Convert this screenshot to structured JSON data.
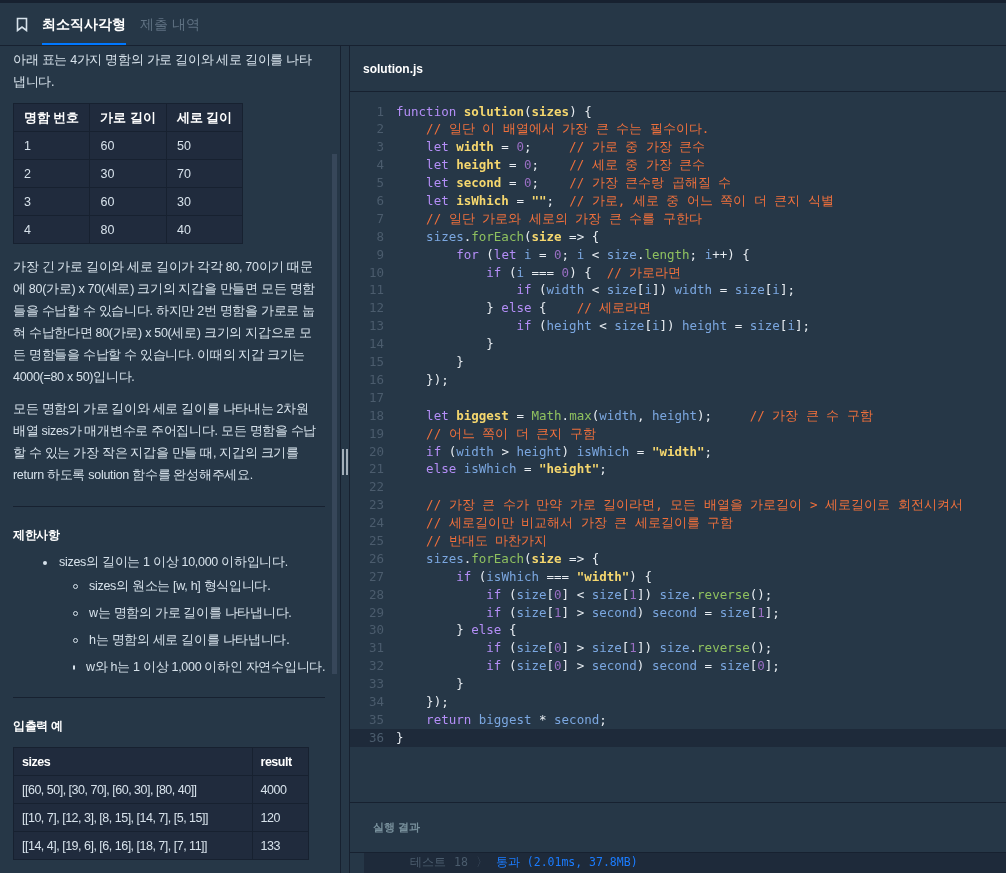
{
  "header": {
    "tabs": [
      {
        "label": "최소직사각형",
        "selected": true
      },
      {
        "label": "제출 내역",
        "selected": false
      }
    ]
  },
  "description": {
    "intro": "아래 표는 4가지 명함의 가로 길이와 세로 길이를 나타냅니다.",
    "cards_table": {
      "columns": [
        "명함 번호",
        "가로 길이",
        "세로 길이"
      ],
      "rows": [
        [
          "1",
          "60",
          "50"
        ],
        [
          "2",
          "30",
          "70"
        ],
        [
          "3",
          "60",
          "30"
        ],
        [
          "4",
          "80",
          "40"
        ]
      ]
    },
    "paragraphs": [
      "가장 긴 가로 길이와 세로 길이가 각각 80, 70이기 때문에 80(가로) x 70(세로) 크기의 지갑을 만들면 모든 명함들을 수납할 수 있습니다. 하지만 2번 명함을 가로로 눕혀 수납한다면 80(가로) x 50(세로) 크기의 지갑으로 모든 명함들을 수납할 수 있습니다. 이때의 지갑 크기는 4000(=80 x 50)입니다.",
      "모든 명함의 가로 길이와 세로 길이를 나타내는 2차원 배열 sizes가 매개변수로 주어집니다. 모든 명함을 수납할 수 있는 가장 작은 지갑을 만들 때, 지갑의 크기를 return 하도록 solution 함수를 완성해주세요."
    ],
    "constraints_title": "제한사항",
    "constraints": [
      {
        "text": "sizes의 길이는 1 이상 10,000 이하입니다.",
        "children": [
          {
            "text": "sizes의 원소는 [w, h] 형식입니다."
          },
          {
            "text": "w는 명함의 가로 길이를 나타냅니다."
          },
          {
            "text": "h는 명함의 세로 길이를 나타냅니다."
          },
          {
            "text": "w와 h는 1 이상 1,000 이하인 자연수입니다."
          }
        ]
      }
    ],
    "examples_title": "입출력 예",
    "examples_table": {
      "columns": [
        "sizes",
        "result"
      ],
      "rows": [
        [
          "[[60, 50], [30, 70], [60, 30], [80, 40]]",
          "4000"
        ],
        [
          "[[10, 7], [12, 3], [8, 15], [14, 7], [5, 15]]",
          "120"
        ],
        [
          "[[14, 4], [19, 6], [6, 16], [18, 7], [7, 11]]",
          "133"
        ]
      ]
    }
  },
  "editor": {
    "filename": "solution.js",
    "lines": [
      {
        "number": "1",
        "current": false,
        "tokens": [
          {
            "kind": "keyword",
            "text": "function"
          },
          {
            "kind": "name",
            "text": " solution"
          },
          {
            "kind": "plain",
            "text": "("
          },
          {
            "kind": "name",
            "text": "sizes"
          },
          {
            "kind": "plain",
            "text": ") {"
          }
        ]
      },
      {
        "number": "2",
        "current": false,
        "tokens": [
          {
            "kind": "comment",
            "text": "    // 일단 이 배열에서 가장 큰 수는 필수이다."
          }
        ]
      },
      {
        "number": "3",
        "current": false,
        "tokens": [
          {
            "kind": "keyword",
            "text": "    let"
          },
          {
            "kind": "name",
            "text": " width"
          },
          {
            "kind": "plain",
            "text": " = "
          },
          {
            "kind": "number",
            "text": "0"
          },
          {
            "kind": "plain",
            "text": ";     "
          },
          {
            "kind": "comment",
            "text": "// 가로 중 가장 큰수"
          }
        ]
      },
      {
        "number": "4",
        "current": false,
        "tokens": [
          {
            "kind": "keyword",
            "text": "    let"
          },
          {
            "kind": "name",
            "text": " height"
          },
          {
            "kind": "plain",
            "text": " = "
          },
          {
            "kind": "number",
            "text": "0"
          },
          {
            "kind": "plain",
            "text": ";    "
          },
          {
            "kind": "comment",
            "text": "// 세로 중 가장 큰수"
          }
        ]
      },
      {
        "number": "5",
        "current": false,
        "tokens": [
          {
            "kind": "keyword",
            "text": "    let"
          },
          {
            "kind": "name",
            "text": " second"
          },
          {
            "kind": "plain",
            "text": " = "
          },
          {
            "kind": "number",
            "text": "0"
          },
          {
            "kind": "plain",
            "text": ";    "
          },
          {
            "kind": "comment",
            "text": "// 가장 큰수랑 곱해질 수"
          }
        ]
      },
      {
        "number": "6",
        "current": false,
        "tokens": [
          {
            "kind": "keyword",
            "text": "    let"
          },
          {
            "kind": "name",
            "text": " isWhich"
          },
          {
            "kind": "plain",
            "text": " = "
          },
          {
            "kind": "string",
            "text": "\"\""
          },
          {
            "kind": "plain",
            "text": ";  "
          },
          {
            "kind": "comment",
            "text": "// 가로, 세로 중 어느 쪽이 더 큰지 식별"
          }
        ]
      },
      {
        "number": "7",
        "current": false,
        "tokens": [
          {
            "kind": "comment",
            "text": "    // 일단 가로와 세로의 가장 큰 수를 구한다"
          }
        ]
      },
      {
        "number": "8",
        "current": false,
        "tokens": [
          {
            "kind": "variable",
            "text": "    sizes"
          },
          {
            "kind": "plain",
            "text": "."
          },
          {
            "kind": "method",
            "text": "forEach"
          },
          {
            "kind": "plain",
            "text": "("
          },
          {
            "kind": "name",
            "text": "size"
          },
          {
            "kind": "plain",
            "text": " => {"
          }
        ]
      },
      {
        "number": "9",
        "current": false,
        "tokens": [
          {
            "kind": "keyword",
            "text": "        for"
          },
          {
            "kind": "plain",
            "text": " ("
          },
          {
            "kind": "keyword",
            "text": "let"
          },
          {
            "kind": "variable",
            "text": " i"
          },
          {
            "kind": "plain",
            "text": " = "
          },
          {
            "kind": "number",
            "text": "0"
          },
          {
            "kind": "plain",
            "text": "; "
          },
          {
            "kind": "variable",
            "text": "i"
          },
          {
            "kind": "plain",
            "text": " < "
          },
          {
            "kind": "variable",
            "text": "size"
          },
          {
            "kind": "plain",
            "text": "."
          },
          {
            "kind": "method",
            "text": "length"
          },
          {
            "kind": "plain",
            "text": "; "
          },
          {
            "kind": "variable",
            "text": "i"
          },
          {
            "kind": "plain",
            "text": "++) {"
          }
        ]
      },
      {
        "number": "10",
        "current": false,
        "tokens": [
          {
            "kind": "keyword",
            "text": "            if"
          },
          {
            "kind": "plain",
            "text": " ("
          },
          {
            "kind": "variable",
            "text": "i"
          },
          {
            "kind": "plain",
            "text": " === "
          },
          {
            "kind": "number",
            "text": "0"
          },
          {
            "kind": "plain",
            "text": ") {  "
          },
          {
            "kind": "comment",
            "text": "// 가로라면"
          }
        ]
      },
      {
        "number": "11",
        "current": false,
        "tokens": [
          {
            "kind": "keyword",
            "text": "                if"
          },
          {
            "kind": "plain",
            "text": " ("
          },
          {
            "kind": "variable",
            "text": "width"
          },
          {
            "kind": "plain",
            "text": " < "
          },
          {
            "kind": "variable",
            "text": "size"
          },
          {
            "kind": "plain",
            "text": "["
          },
          {
            "kind": "variable",
            "text": "i"
          },
          {
            "kind": "plain",
            "text": "]) "
          },
          {
            "kind": "variable",
            "text": "width"
          },
          {
            "kind": "plain",
            "text": " = "
          },
          {
            "kind": "variable",
            "text": "size"
          },
          {
            "kind": "plain",
            "text": "["
          },
          {
            "kind": "variable",
            "text": "i"
          },
          {
            "kind": "plain",
            "text": "];"
          }
        ]
      },
      {
        "number": "12",
        "current": false,
        "tokens": [
          {
            "kind": "plain",
            "text": "            } "
          },
          {
            "kind": "keyword",
            "text": "else"
          },
          {
            "kind": "plain",
            "text": " {    "
          },
          {
            "kind": "comment",
            "text": "// 세로라면"
          }
        ]
      },
      {
        "number": "13",
        "current": false,
        "tokens": [
          {
            "kind": "keyword",
            "text": "                if"
          },
          {
            "kind": "plain",
            "text": " ("
          },
          {
            "kind": "variable",
            "text": "height"
          },
          {
            "kind": "plain",
            "text": " < "
          },
          {
            "kind": "variable",
            "text": "size"
          },
          {
            "kind": "plain",
            "text": "["
          },
          {
            "kind": "variable",
            "text": "i"
          },
          {
            "kind": "plain",
            "text": "]) "
          },
          {
            "kind": "variable",
            "text": "height"
          },
          {
            "kind": "plain",
            "text": " = "
          },
          {
            "kind": "variable",
            "text": "size"
          },
          {
            "kind": "plain",
            "text": "["
          },
          {
            "kind": "variable",
            "text": "i"
          },
          {
            "kind": "plain",
            "text": "];"
          }
        ]
      },
      {
        "number": "14",
        "current": false,
        "tokens": [
          {
            "kind": "plain",
            "text": "            }"
          }
        ]
      },
      {
        "number": "15",
        "current": false,
        "tokens": [
          {
            "kind": "plain",
            "text": "        }"
          }
        ]
      },
      {
        "number": "16",
        "current": false,
        "tokens": [
          {
            "kind": "plain",
            "text": "    });"
          }
        ]
      },
      {
        "number": "17",
        "current": false
      },
      {
        "number": "18",
        "current": false,
        "tokens": [
          {
            "kind": "keyword",
            "text": "    let"
          },
          {
            "kind": "name",
            "text": " biggest"
          },
          {
            "kind": "plain",
            "text": " = "
          },
          {
            "kind": "method",
            "text": "Math"
          },
          {
            "kind": "plain",
            "text": "."
          },
          {
            "kind": "method",
            "text": "max"
          },
          {
            "kind": "plain",
            "text": "("
          },
          {
            "kind": "variable",
            "text": "width"
          },
          {
            "kind": "plain",
            "text": ", "
          },
          {
            "kind": "variable",
            "text": "height"
          },
          {
            "kind": "plain",
            "text": ");     "
          },
          {
            "kind": "comment",
            "text": "// 가장 큰 수 구함"
          }
        ]
      },
      {
        "number": "19",
        "current": false,
        "tokens": [
          {
            "kind": "comment",
            "text": "    // 어느 쪽이 더 큰지 구함"
          }
        ]
      },
      {
        "number": "20",
        "current": false,
        "tokens": [
          {
            "kind": "keyword",
            "text": "    if"
          },
          {
            "kind": "plain",
            "text": " ("
          },
          {
            "kind": "variable",
            "text": "width"
          },
          {
            "kind": "plain",
            "text": " > "
          },
          {
            "kind": "variable",
            "text": "height"
          },
          {
            "kind": "plain",
            "text": ") "
          },
          {
            "kind": "variable",
            "text": "isWhich"
          },
          {
            "kind": "plain",
            "text": " = "
          },
          {
            "kind": "string",
            "text": "\"width\""
          },
          {
            "kind": "plain",
            "text": ";"
          }
        ]
      },
      {
        "number": "21",
        "current": false,
        "tokens": [
          {
            "kind": "keyword",
            "text": "    else"
          },
          {
            "kind": "variable",
            "text": " isWhich"
          },
          {
            "kind": "plain",
            "text": " = "
          },
          {
            "kind": "string",
            "text": "\"height\""
          },
          {
            "kind": "plain",
            "text": ";"
          }
        ]
      },
      {
        "number": "22",
        "current": false
      },
      {
        "number": "23",
        "current": false,
        "tokens": [
          {
            "kind": "comment",
            "text": "    // 가장 큰 수가 만약 가로 길이라면, 모든 배열을 가로길이 > 세로길이로 회전시켜서"
          }
        ]
      },
      {
        "number": "24",
        "current": false,
        "tokens": [
          {
            "kind": "comment",
            "text": "    // 세로길이만 비교해서 가장 큰 세로길이를 구함"
          }
        ]
      },
      {
        "number": "25",
        "current": false,
        "tokens": [
          {
            "kind": "comment",
            "text": "    // 반대도 마찬가지"
          }
        ]
      },
      {
        "number": "26",
        "current": false,
        "tokens": [
          {
            "kind": "variable",
            "text": "    sizes"
          },
          {
            "kind": "plain",
            "text": "."
          },
          {
            "kind": "method",
            "text": "forEach"
          },
          {
            "kind": "plain",
            "text": "("
          },
          {
            "kind": "name",
            "text": "size"
          },
          {
            "kind": "plain",
            "text": " => {"
          }
        ]
      },
      {
        "number": "27",
        "current": false,
        "tokens": [
          {
            "kind": "keyword",
            "text": "        if"
          },
          {
            "kind": "plain",
            "text": " ("
          },
          {
            "kind": "variable",
            "text": "isWhich"
          },
          {
            "kind": "plain",
            "text": " === "
          },
          {
            "kind": "string",
            "text": "\"width\""
          },
          {
            "kind": "plain",
            "text": ") {"
          }
        ]
      },
      {
        "number": "28",
        "current": false,
        "tokens": [
          {
            "kind": "keyword",
            "text": "            if"
          },
          {
            "kind": "plain",
            "text": " ("
          },
          {
            "kind": "variable",
            "text": "size"
          },
          {
            "kind": "plain",
            "text": "["
          },
          {
            "kind": "number",
            "text": "0"
          },
          {
            "kind": "plain",
            "text": "] < "
          },
          {
            "kind": "variable",
            "text": "size"
          },
          {
            "kind": "plain",
            "text": "["
          },
          {
            "kind": "number",
            "text": "1"
          },
          {
            "kind": "plain",
            "text": "]) "
          },
          {
            "kind": "variable",
            "text": "size"
          },
          {
            "kind": "plain",
            "text": "."
          },
          {
            "kind": "method",
            "text": "reverse"
          },
          {
            "kind": "plain",
            "text": "();"
          }
        ]
      },
      {
        "number": "29",
        "current": false,
        "tokens": [
          {
            "kind": "keyword",
            "text": "            if"
          },
          {
            "kind": "plain",
            "text": " ("
          },
          {
            "kind": "variable",
            "text": "size"
          },
          {
            "kind": "plain",
            "text": "["
          },
          {
            "kind": "number",
            "text": "1"
          },
          {
            "kind": "plain",
            "text": "] > "
          },
          {
            "kind": "variable",
            "text": "second"
          },
          {
            "kind": "plain",
            "text": ") "
          },
          {
            "kind": "variable",
            "text": "second"
          },
          {
            "kind": "plain",
            "text": " = "
          },
          {
            "kind": "variable",
            "text": "size"
          },
          {
            "kind": "plain",
            "text": "["
          },
          {
            "kind": "number",
            "text": "1"
          },
          {
            "kind": "plain",
            "text": "];"
          }
        ]
      },
      {
        "number": "30",
        "current": false,
        "tokens": [
          {
            "kind": "plain",
            "text": "        } "
          },
          {
            "kind": "keyword",
            "text": "else"
          },
          {
            "kind": "plain",
            "text": " {"
          }
        ]
      },
      {
        "number": "31",
        "current": false,
        "tokens": [
          {
            "kind": "keyword",
            "text": "            if"
          },
          {
            "kind": "plain",
            "text": " ("
          },
          {
            "kind": "variable",
            "text": "size"
          },
          {
            "kind": "plain",
            "text": "["
          },
          {
            "kind": "number",
            "text": "0"
          },
          {
            "kind": "plain",
            "text": "] > "
          },
          {
            "kind": "variable",
            "text": "size"
          },
          {
            "kind": "plain",
            "text": "["
          },
          {
            "kind": "number",
            "text": "1"
          },
          {
            "kind": "plain",
            "text": "]) "
          },
          {
            "kind": "variable",
            "text": "size"
          },
          {
            "kind": "plain",
            "text": "."
          },
          {
            "kind": "method",
            "text": "reverse"
          },
          {
            "kind": "plain",
            "text": "();"
          }
        ]
      },
      {
        "number": "32",
        "current": false,
        "tokens": [
          {
            "kind": "keyword",
            "text": "            if"
          },
          {
            "kind": "plain",
            "text": " ("
          },
          {
            "kind": "variable",
            "text": "size"
          },
          {
            "kind": "plain",
            "text": "["
          },
          {
            "kind": "number",
            "text": "0"
          },
          {
            "kind": "plain",
            "text": "] > "
          },
          {
            "kind": "variable",
            "text": "second"
          },
          {
            "kind": "plain",
            "text": ") "
          },
          {
            "kind": "variable",
            "text": "second"
          },
          {
            "kind": "plain",
            "text": " = "
          },
          {
            "kind": "variable",
            "text": "size"
          },
          {
            "kind": "plain",
            "text": "["
          },
          {
            "kind": "number",
            "text": "0"
          },
          {
            "kind": "plain",
            "text": "];"
          }
        ]
      },
      {
        "number": "33",
        "current": false,
        "tokens": [
          {
            "kind": "plain",
            "text": "        }"
          }
        ]
      },
      {
        "number": "34",
        "current": false,
        "tokens": [
          {
            "kind": "plain",
            "text": "    });"
          }
        ]
      },
      {
        "number": "35",
        "current": false,
        "tokens": [
          {
            "kind": "keyword",
            "text": "    return"
          },
          {
            "kind": "variable",
            "text": " biggest"
          },
          {
            "kind": "plain",
            "text": " * "
          },
          {
            "kind": "variable",
            "text": "second"
          },
          {
            "kind": "plain",
            "text": ";"
          }
        ]
      },
      {
        "number": "36",
        "current": true,
        "tokens": [
          {
            "kind": "plain",
            "text": "}"
          }
        ]
      }
    ]
  },
  "results": {
    "title": "실행 결과",
    "rows": [
      {
        "label": "테스트",
        "number": "18",
        "separator": "〉",
        "result": "통과 (2.01ms, 37.8MB)"
      }
    ]
  }
}
